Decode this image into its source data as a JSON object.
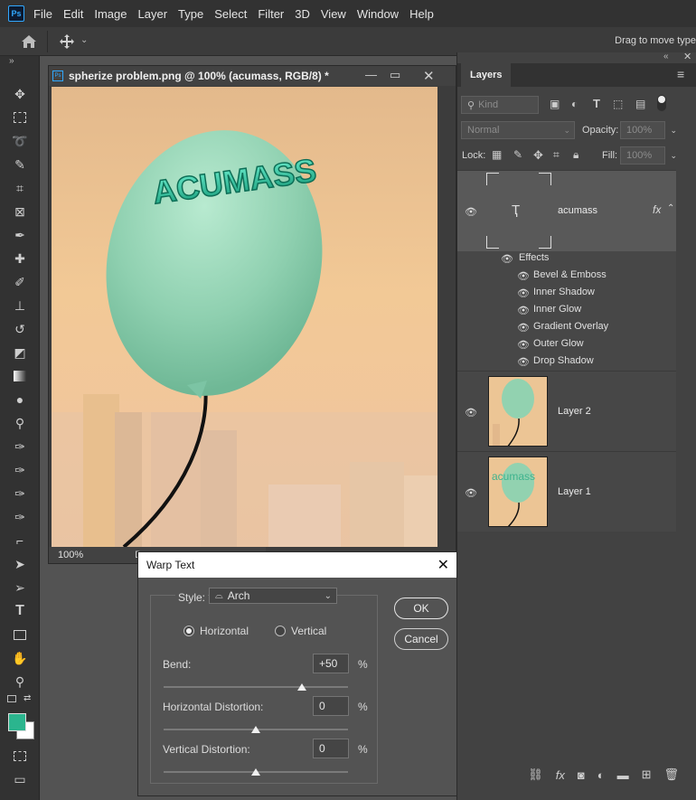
{
  "menubar": {
    "items": [
      "File",
      "Edit",
      "Image",
      "Layer",
      "Type",
      "Select",
      "Filter",
      "3D",
      "View",
      "Window",
      "Help"
    ]
  },
  "options_bar": {
    "hint": "Drag to move type"
  },
  "document": {
    "title": "spherize problem.png @ 100% (acumass, RGB/8) *",
    "zoom": "100%",
    "status_fragment": "D",
    "canvas_text": "ACUMASS"
  },
  "colors": {
    "foreground": "#2bb58e",
    "background": "#ffffff",
    "accent": "#31a8ff"
  },
  "layers_panel": {
    "tab": "Layers",
    "kind_placeholder": "Kind",
    "blend_mode": "Normal",
    "opacity_label": "Opacity:",
    "opacity_value": "100%",
    "lock_label": "Lock:",
    "fill_label": "Fill:",
    "fill_value": "100%",
    "layers": [
      {
        "name": "acumass",
        "type": "text",
        "selected": true,
        "fx": "fx"
      },
      {
        "name": "Layer 2",
        "type": "image"
      },
      {
        "name": "Layer 1",
        "type": "image",
        "thumb_text": "acumass"
      }
    ],
    "effects_label": "Effects",
    "effects": [
      "Bevel & Emboss",
      "Inner Shadow",
      "Inner Glow",
      "Gradient Overlay",
      "Outer Glow",
      "Drop Shadow"
    ]
  },
  "warp_dialog": {
    "title": "Warp Text",
    "style_label": "Style:",
    "style_value": "Arch",
    "horizontal_label": "Horizontal",
    "vertical_label": "Vertical",
    "orientation": "Horizontal",
    "bend_label": "Bend:",
    "bend_value": "+50",
    "bend_level": 50,
    "hdist_label": "Horizontal Distortion:",
    "hdist_value": "0",
    "hdist_level": 0,
    "vdist_label": "Vertical Distortion:",
    "vdist_value": "0",
    "vdist_level": 0,
    "percent": "%",
    "ok_label": "OK",
    "cancel_label": "Cancel"
  }
}
